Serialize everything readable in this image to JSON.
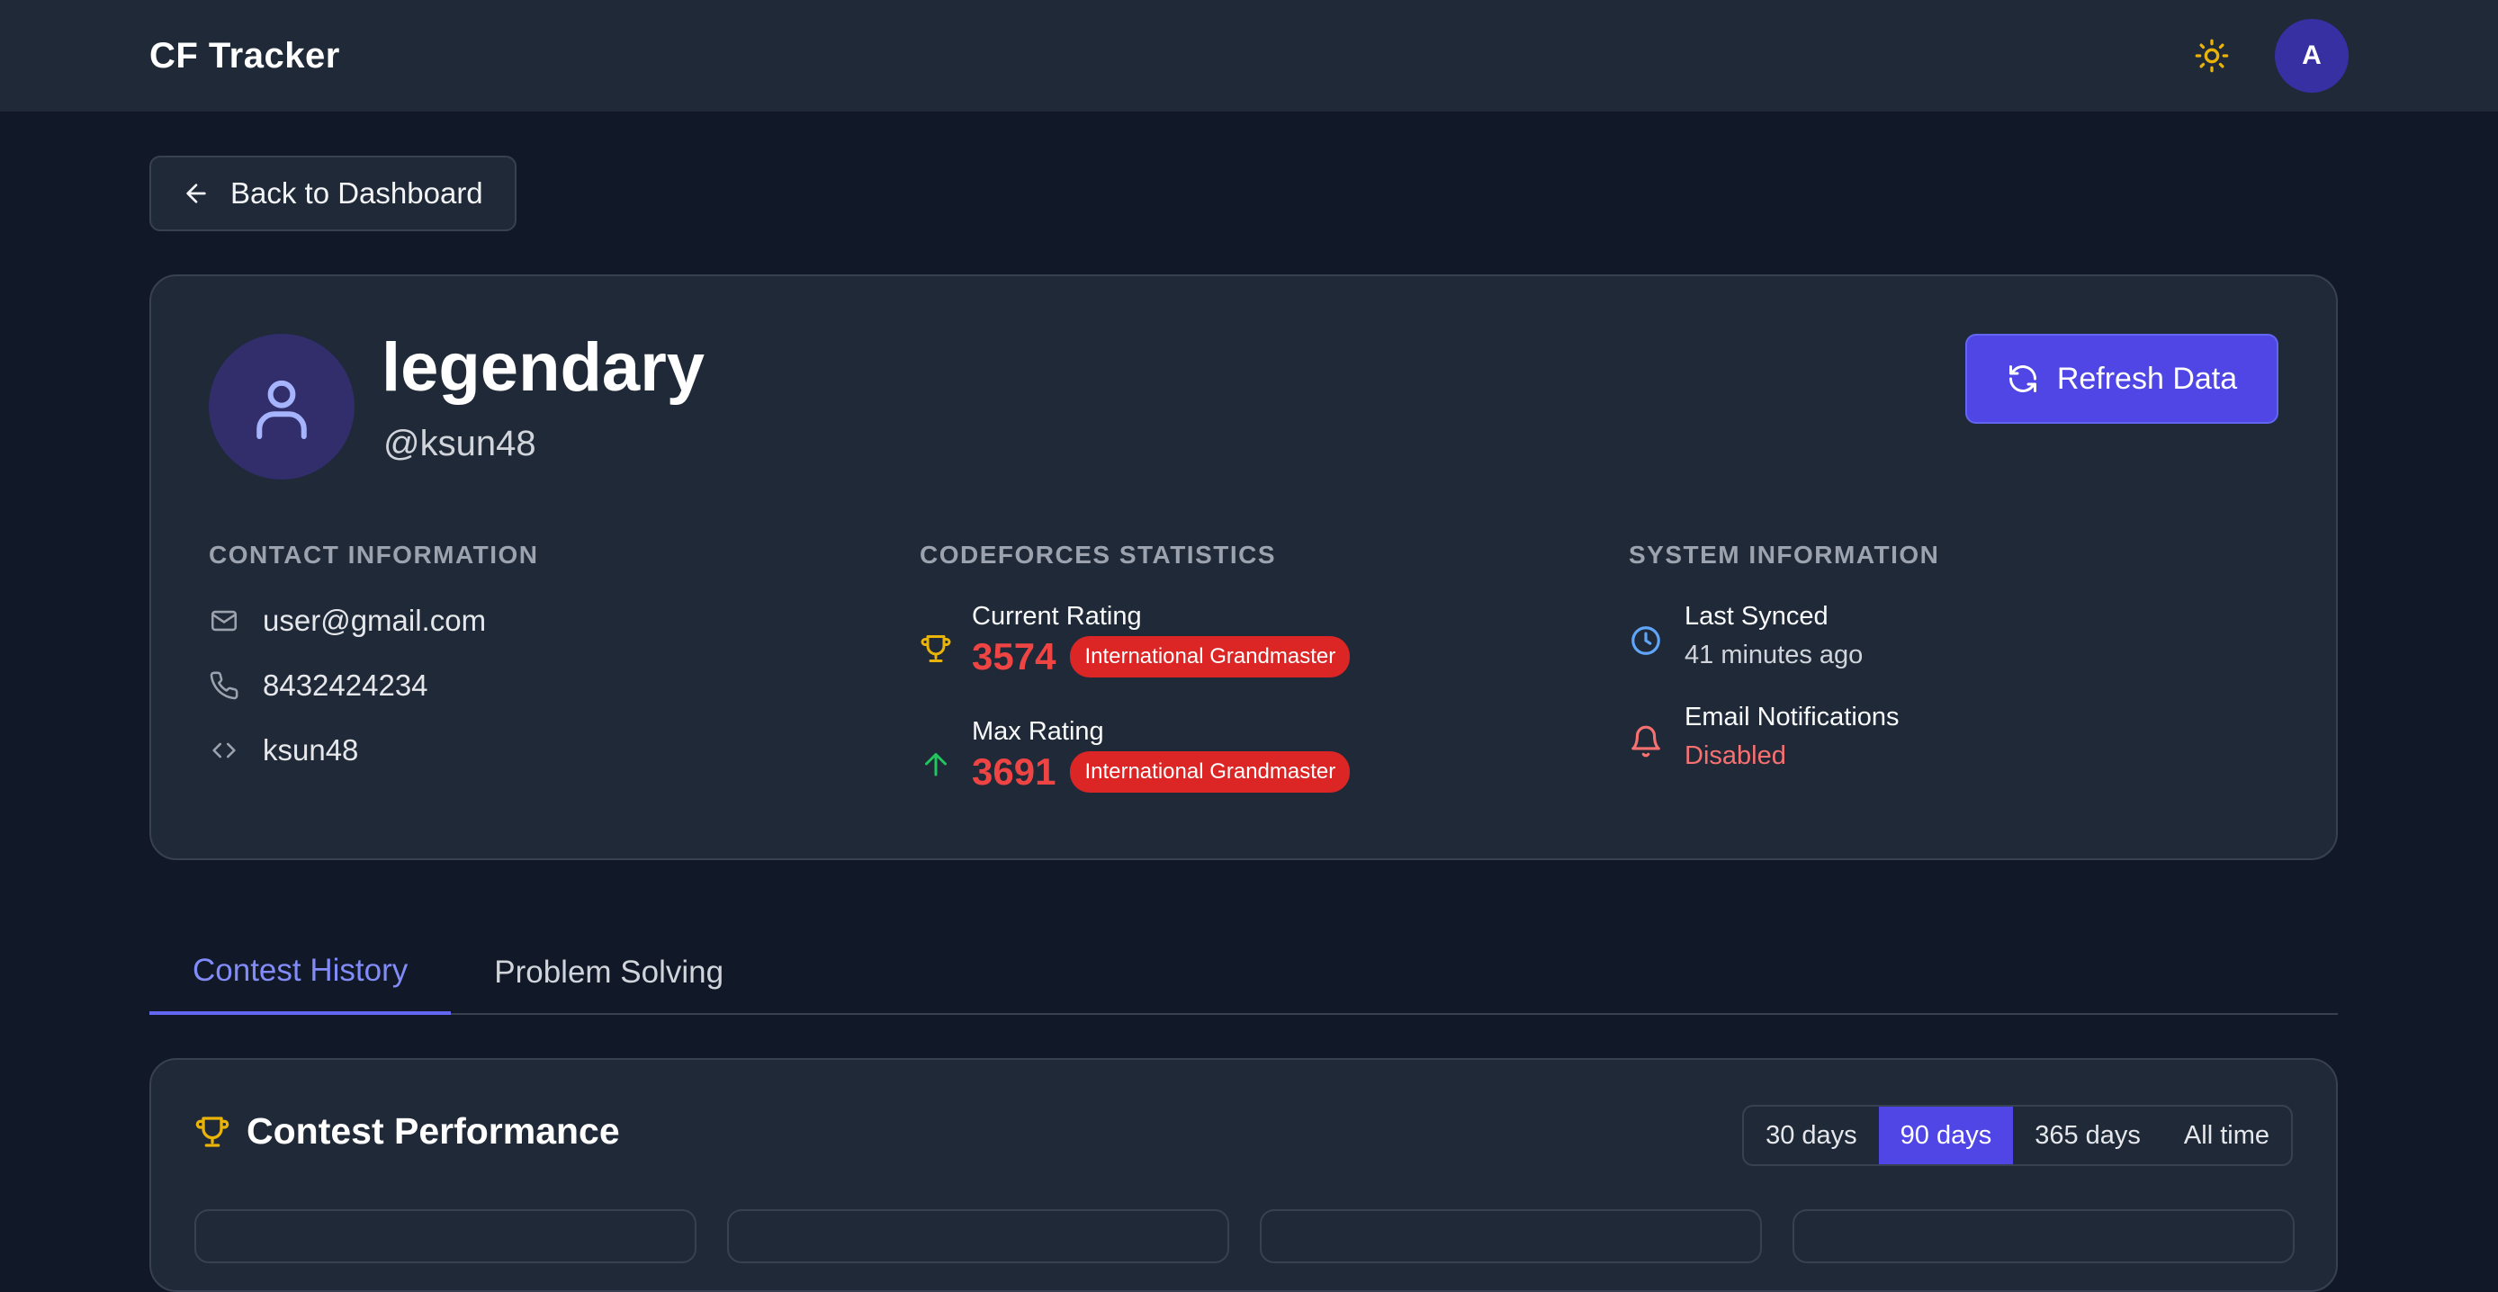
{
  "header": {
    "brand": "CF Tracker",
    "theme_icon": "sun-icon",
    "avatar_initial": "A"
  },
  "back_button": {
    "label": "Back to Dashboard",
    "icon": "arrow-left-icon"
  },
  "profile": {
    "name": "legendary",
    "handle": "@ksun48",
    "refresh_label": "Refresh Data"
  },
  "contact": {
    "title": "CONTACT INFORMATION",
    "email": "user@gmail.com",
    "phone": "8432424234",
    "cf_handle": "ksun48"
  },
  "stats": {
    "title": "CODEFORCES STATISTICS",
    "current": {
      "label": "Current Rating",
      "value": "3574",
      "rank": "International Grandmaster"
    },
    "max": {
      "label": "Max Rating",
      "value": "3691",
      "rank": "International Grandmaster"
    }
  },
  "system": {
    "title": "SYSTEM INFORMATION",
    "synced_label": "Last Synced",
    "synced_value": "41 minutes ago",
    "notif_label": "Email Notifications",
    "notif_value": "Disabled"
  },
  "tabs": [
    {
      "label": "Contest History",
      "active": true
    },
    {
      "label": "Problem Solving",
      "active": false
    }
  ],
  "performance": {
    "title": "Contest Performance",
    "ranges": [
      {
        "label": "30 days",
        "active": false
      },
      {
        "label": "90 days",
        "active": true
      },
      {
        "label": "365 days",
        "active": false
      },
      {
        "label": "All time",
        "active": false
      }
    ]
  },
  "colors": {
    "accent": "#4f46e5",
    "rating_red": "#ef4444",
    "disabled_red": "#f87171",
    "trophy_gold": "#eab308",
    "arrow_green": "#22c55e",
    "clock_blue": "#60a5fa"
  }
}
